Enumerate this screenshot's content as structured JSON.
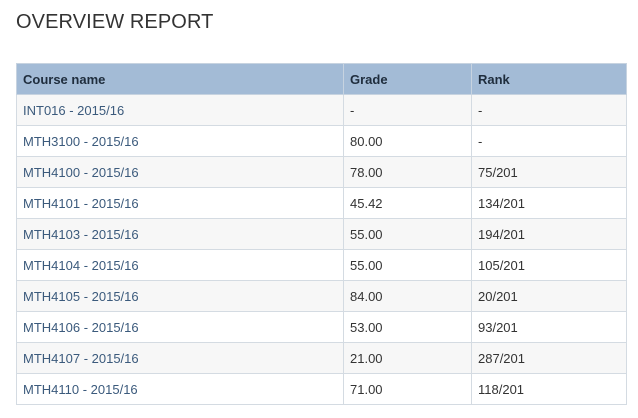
{
  "page": {
    "title": "OVERVIEW REPORT"
  },
  "table": {
    "headers": {
      "course_name": "Course name",
      "grade": "Grade",
      "rank": "Rank"
    },
    "rows": [
      {
        "course": "INT016 - 2015/16",
        "grade": "-",
        "rank": "-"
      },
      {
        "course": "MTH3100 - 2015/16",
        "grade": "80.00",
        "rank": "-"
      },
      {
        "course": "MTH4100 - 2015/16",
        "grade": "78.00",
        "rank": "75/201"
      },
      {
        "course": "MTH4101 - 2015/16",
        "grade": "45.42",
        "rank": "134/201"
      },
      {
        "course": "MTH4103 - 2015/16",
        "grade": "55.00",
        "rank": "194/201"
      },
      {
        "course": "MTH4104 - 2015/16",
        "grade": "55.00",
        "rank": "105/201"
      },
      {
        "course": "MTH4105 - 2015/16",
        "grade": "84.00",
        "rank": "20/201"
      },
      {
        "course": "MTH4106 - 2015/16",
        "grade": "53.00",
        "rank": "93/201"
      },
      {
        "course": "MTH4107 - 2015/16",
        "grade": "21.00",
        "rank": "287/201"
      },
      {
        "course": "MTH4110 - 2015/16",
        "grade": "71.00",
        "rank": "118/201"
      }
    ]
  }
}
